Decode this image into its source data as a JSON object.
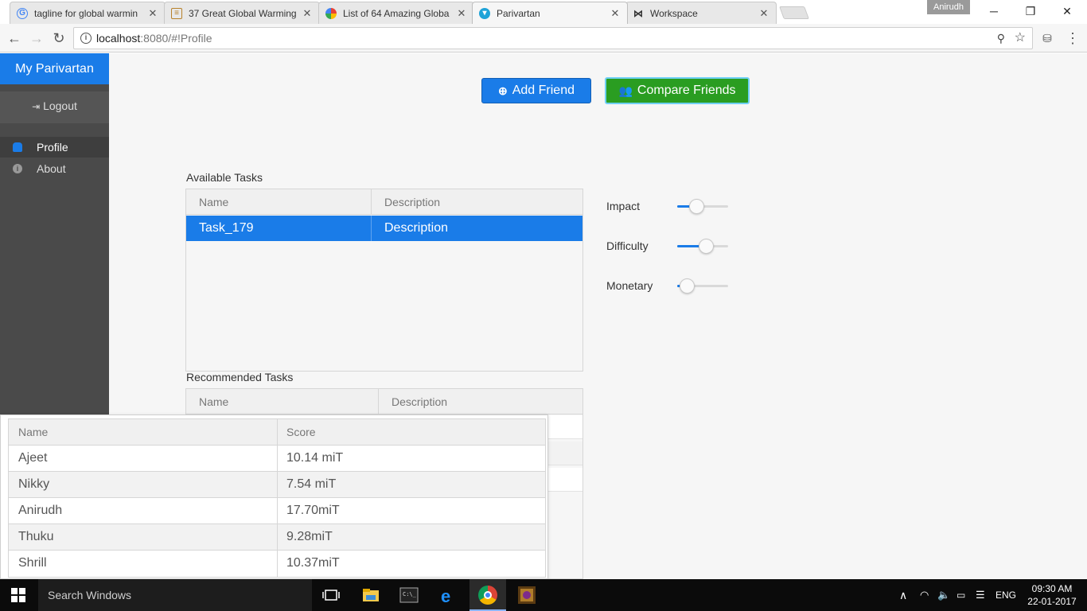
{
  "browser": {
    "tabs": [
      {
        "title": "tagline for global warmin",
        "icon": "google-icon"
      },
      {
        "title": "37 Great Global Warming",
        "icon": "page-icon"
      },
      {
        "title": "List of 64 Amazing Globa",
        "icon": "pinwheel-icon"
      },
      {
        "title": "Parivartan",
        "icon": "app-icon",
        "active": true
      },
      {
        "title": "Workspace",
        "icon": "bow-icon"
      }
    ],
    "profile_name": "Anirudh",
    "url_host": "localhost",
    "url_rest": ":8080/#!Profile"
  },
  "sidebar": {
    "brand": "My Parivartan",
    "logout": "Logout",
    "items": [
      {
        "label": "Profile",
        "icon": "user-icon",
        "active": true
      },
      {
        "label": "About",
        "icon": "info-icon",
        "active": false
      }
    ]
  },
  "actions": {
    "add_friend": "Add Friend",
    "compare_friends": "Compare Friends"
  },
  "available_tasks": {
    "label": "Available Tasks",
    "columns": [
      "Name",
      "Description"
    ],
    "rows": [
      {
        "name": "Task_179",
        "description": "Description",
        "selected": true
      }
    ]
  },
  "recommended_tasks": {
    "label": "Recommended Tasks",
    "columns": [
      "Name",
      "Description"
    ]
  },
  "sliders": [
    {
      "label": "Impact",
      "value": 0.38
    },
    {
      "label": "Difficulty",
      "value": 0.56
    },
    {
      "label": "Monetary",
      "value": 0.18
    }
  ],
  "friends_popup": {
    "columns": [
      "Name",
      "Score"
    ],
    "rows": [
      {
        "name": "Ajeet",
        "score": "10.14 miT"
      },
      {
        "name": "Nikky",
        "score": "7.54 miT"
      },
      {
        "name": "Anirudh",
        "score": "17.70miT"
      },
      {
        "name": "Thuku",
        "score": "9.28miT"
      },
      {
        "name": "Shrill",
        "score": "10.37miT"
      }
    ]
  },
  "taskbar": {
    "search_placeholder": "Search Windows",
    "language": "ENG",
    "time": "09:30 AM",
    "date": "22-01-2017"
  },
  "colors": {
    "accent_blue": "#1a7ce8",
    "accent_green": "#2a9d21",
    "sidebar_bg": "#4a4a4a"
  }
}
